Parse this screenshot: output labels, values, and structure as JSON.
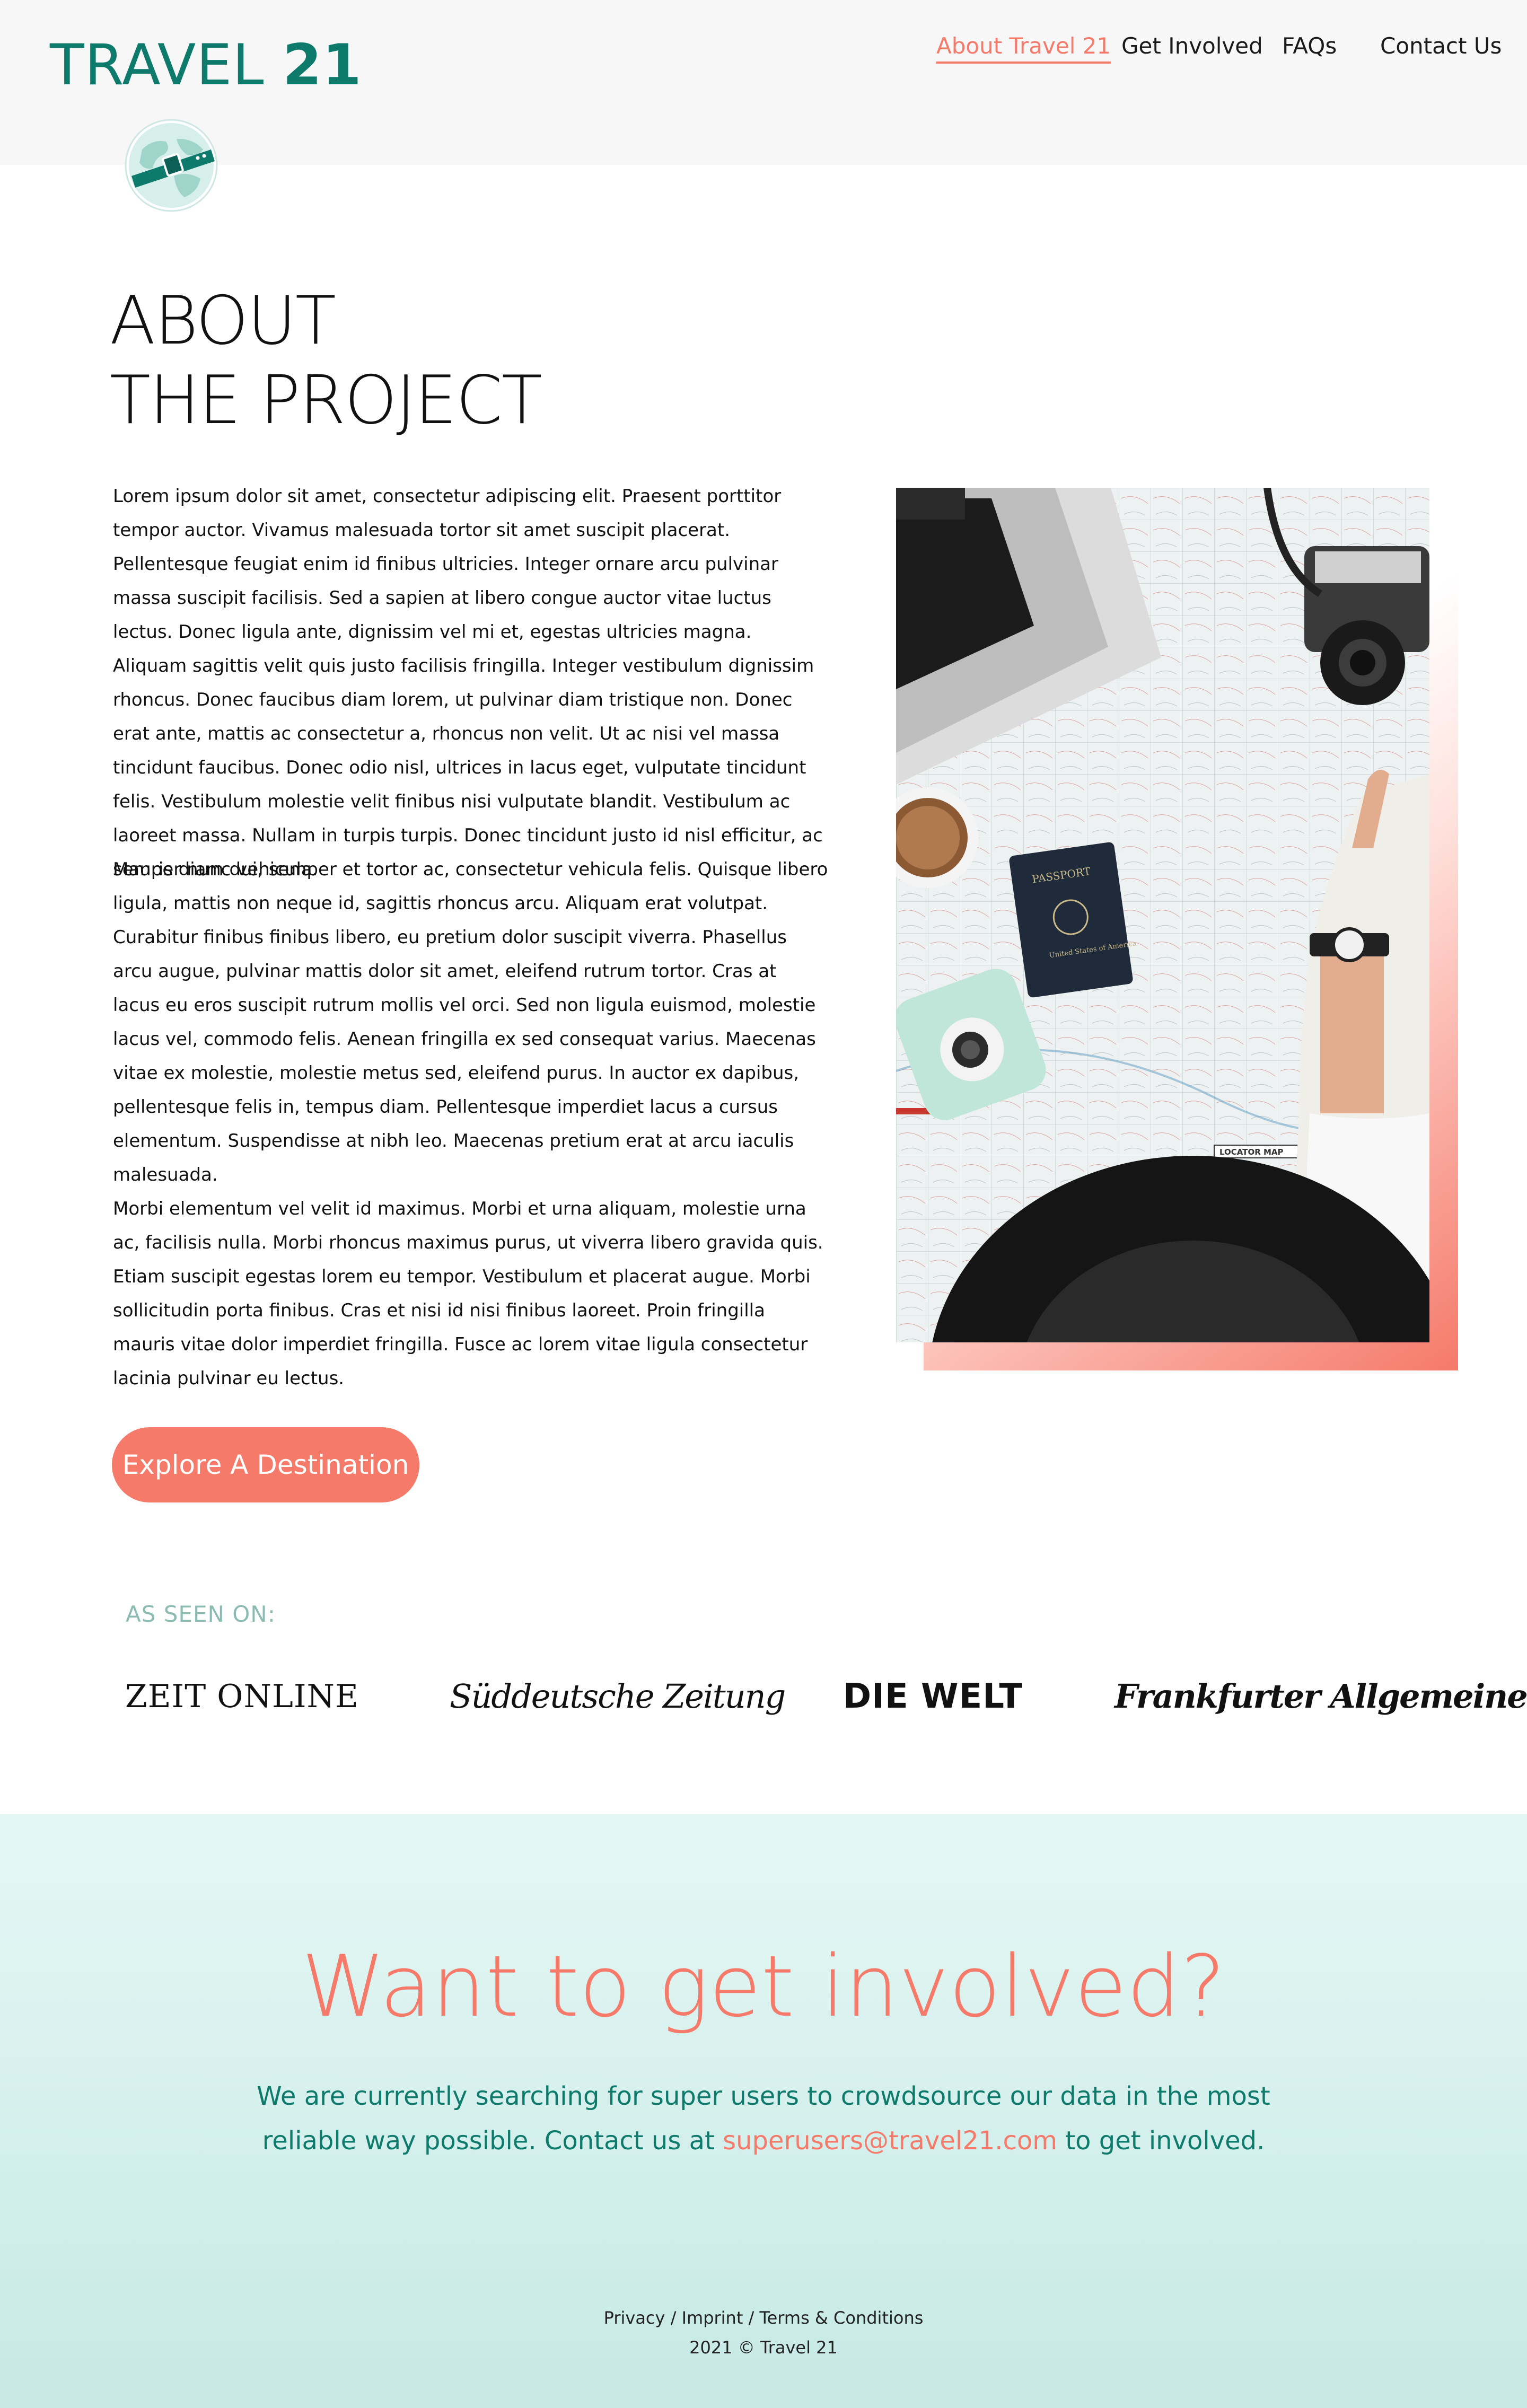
{
  "header": {
    "logo_word": "TRAVEL",
    "logo_number": "21",
    "nav": [
      {
        "label": "About Travel 21"
      },
      {
        "label": "Get Involved"
      },
      {
        "label": "FAQs"
      },
      {
        "label": "Contact Us"
      }
    ]
  },
  "about": {
    "title_line1": "ABOUT",
    "title_line2": "THE PROJECT",
    "paragraphs": [
      "Lorem ipsum dolor sit amet, consectetur adipiscing elit. Praesent porttitor tempor auctor. Vivamus malesuada tortor sit amet suscipit placerat. Pellentesque feugiat enim id finibus ultricies. Integer ornare arcu pulvinar massa suscipit facilisis. Sed a sapien at libero congue auctor vitae luctus lectus. Donec ligula ante, dignissim vel mi et, egestas ultricies magna. Aliquam sagittis velit quis justo facilisis fringilla. Integer vestibulum dignissim rhoncus. Donec faucibus diam lorem, ut pulvinar diam tristique non. Donec erat ante, mattis ac consectetur a, rhoncus non velit. Ut ac nisi vel massa tincidunt faucibus. Donec odio nisl, ultrices in lacus eget, vulputate tincidunt felis. Vestibulum molestie velit finibus nisi vulputate blandit. Vestibulum ac laoreet massa. Nullam in turpis turpis. Donec tincidunt justo id nisl efficitur, ac semper nunc vehicula.",
      "Mauris diam dui, semper et tortor ac, consectetur vehicula felis. Quisque libero ligula, mattis non neque id, sagittis rhoncus arcu. Aliquam erat volutpat. Curabitur finibus finibus libero, eu pretium dolor suscipit viverra. Phasellus arcu augue, pulvinar mattis dolor sit amet, eleifend rutrum tortor. Cras at lacus eu eros suscipit rutrum mollis vel orci. Sed non ligula euismod, molestie lacus vel, commodo felis. Aenean fringilla ex sed consequat varius. Maecenas vitae ex molestie, molestie metus sed, eleifend purus. In auctor ex dapibus, pellentesque felis in, tempus diam. Pellentesque imperdiet lacus a cursus elementum. Suspendisse at nibh leo. Maecenas pretium erat at arcu iaculis malesuada.",
      "Morbi elementum vel velit id maximus. Morbi et urna aliquam, molestie urna ac, facilisis nulla. Morbi rhoncus maximus purus, ut viverra libero gravida quis. Etiam suscipit egestas lorem eu tempor. Vestibulum et placerat augue. Morbi sollicitudin porta finibus. Cras et nisi id nisi finibus laoreet. Proin fringilla mauris vitae dolor imperdiet fringilla. Fusce ac lorem vitae ligula consectetur lacinia pulvinar eu lectus."
    ],
    "passport_text": "PASSPORT",
    "passport_country": "United States of America",
    "map_label": "LOCATOR MAP",
    "cta_label": "Explore A Destination"
  },
  "press": {
    "label": "AS SEEN ON:",
    "logos": [
      "ZEIT ONLINE",
      "Süddeutsche Zeitung",
      "DIE WELT",
      "Frankfurter Allgemeine"
    ]
  },
  "involved": {
    "title": "Want to get involved?",
    "text_before": "We are currently searching for super users to crowdsource our data in the most reliable way possible. Contact us at ",
    "email": "superusers@travel21.com",
    "text_after": " to get involved."
  },
  "footer": {
    "privacy": "Privacy",
    "imprint": "Imprint",
    "terms": "Terms & Conditions",
    "separator": " / ",
    "copyright": "2021 © Travel 21"
  },
  "colors": {
    "brand_teal": "#0e7a6c",
    "accent_coral": "#f57a6a",
    "header_bg": "#f7f7f7",
    "involved_bg": "#d4efeb"
  }
}
